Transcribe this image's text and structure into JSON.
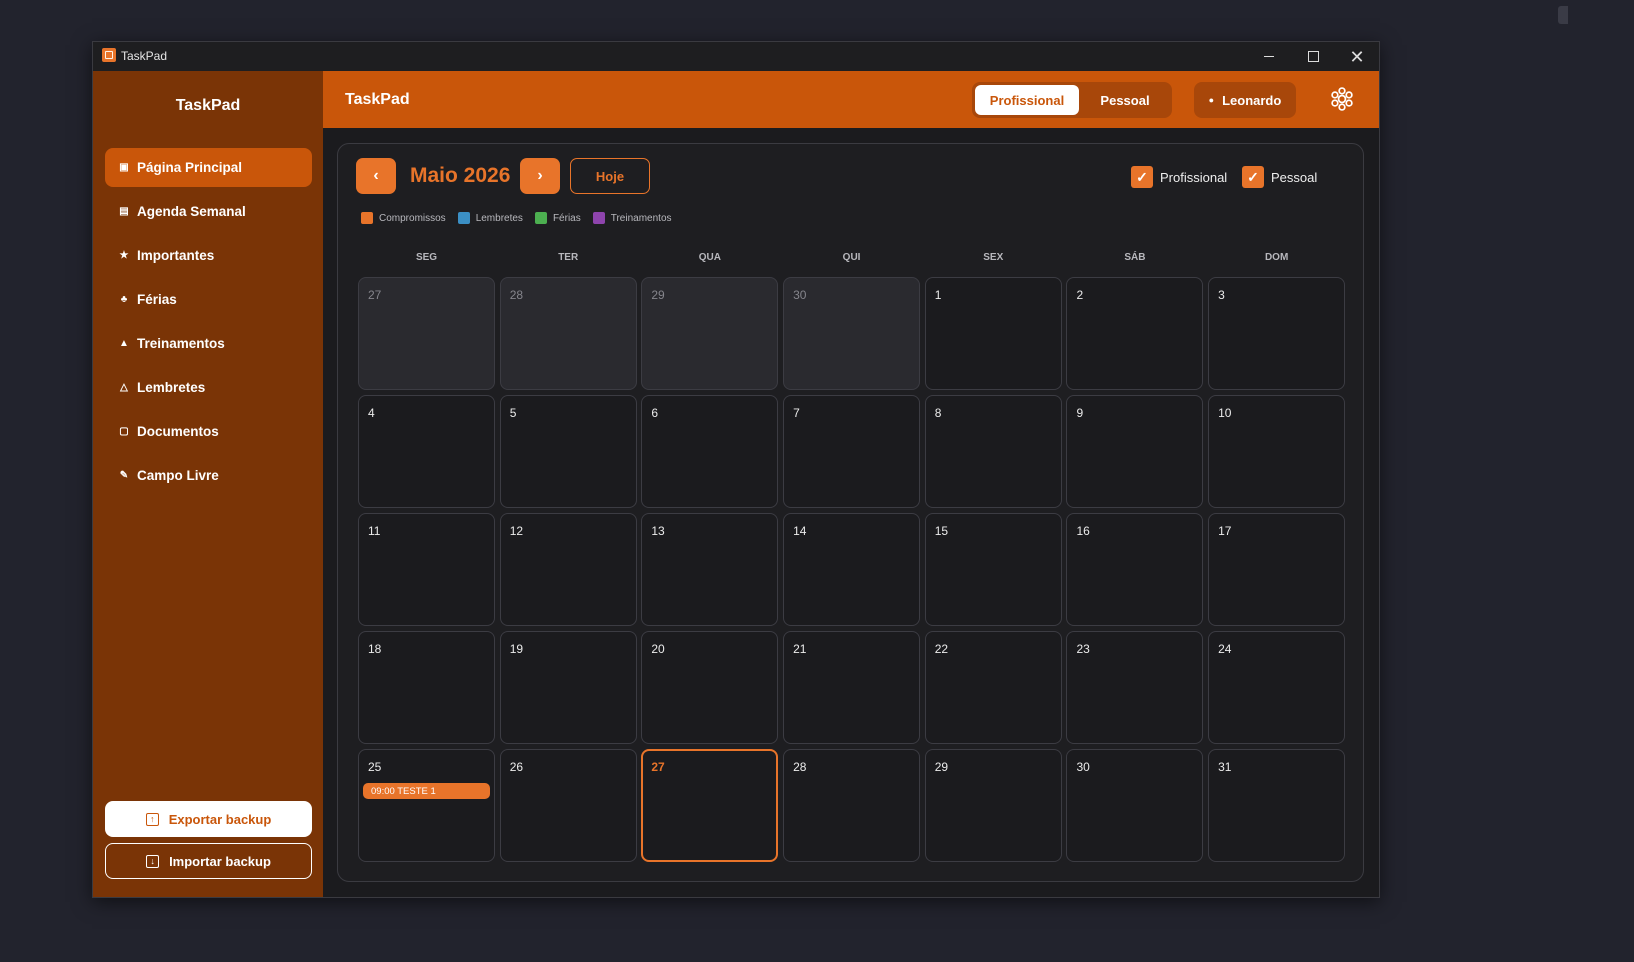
{
  "window": {
    "title": "TaskPad"
  },
  "sidebar": {
    "title": "TaskPad",
    "items": [
      {
        "label": "Página Principal",
        "icon": "calendar-icon",
        "active": true
      },
      {
        "label": "Agenda Semanal",
        "icon": "calendar-week-icon",
        "active": false
      },
      {
        "label": "Importantes",
        "icon": "star-icon",
        "active": false
      },
      {
        "label": "Férias",
        "icon": "palm-tree-icon",
        "active": false
      },
      {
        "label": "Treinamentos",
        "icon": "graduation-cap-icon",
        "active": false
      },
      {
        "label": "Lembretes",
        "icon": "bell-icon",
        "active": false
      },
      {
        "label": "Documentos",
        "icon": "lock-icon",
        "active": false
      },
      {
        "label": "Campo Livre",
        "icon": "pencil-icon",
        "active": false
      }
    ],
    "export_label": "Exportar backup",
    "import_label": "Importar backup"
  },
  "header": {
    "title": "TaskPad",
    "mode_options": [
      "Profissional",
      "Pessoal"
    ],
    "mode_selected": "Profissional",
    "user_name": "Leonardo"
  },
  "calendar": {
    "month_label": "Maio 2026",
    "prev_label": "‹",
    "next_label": "›",
    "today_label": "Hoje",
    "filters": [
      {
        "label": "Profissional",
        "checked": true
      },
      {
        "label": "Pessoal",
        "checked": true
      }
    ],
    "legend": [
      {
        "label": "Compromissos",
        "color": "#e8742a"
      },
      {
        "label": "Lembretes",
        "color": "#3b8fc4"
      },
      {
        "label": "Férias",
        "color": "#4caf50"
      },
      {
        "label": "Treinamentos",
        "color": "#8e44ad"
      }
    ],
    "weekdays": [
      "SEG",
      "TER",
      "QUA",
      "QUI",
      "SEX",
      "SÁB",
      "DOM"
    ],
    "weeks": [
      [
        {
          "day": "27",
          "other": true
        },
        {
          "day": "28",
          "other": true
        },
        {
          "day": "29",
          "other": true
        },
        {
          "day": "30",
          "other": true
        },
        {
          "day": "1"
        },
        {
          "day": "2"
        },
        {
          "day": "3"
        }
      ],
      [
        {
          "day": "4"
        },
        {
          "day": "5"
        },
        {
          "day": "6"
        },
        {
          "day": "7"
        },
        {
          "day": "8"
        },
        {
          "day": "9"
        },
        {
          "day": "10"
        }
      ],
      [
        {
          "day": "11"
        },
        {
          "day": "12"
        },
        {
          "day": "13"
        },
        {
          "day": "14"
        },
        {
          "day": "15"
        },
        {
          "day": "16"
        },
        {
          "day": "17"
        }
      ],
      [
        {
          "day": "18"
        },
        {
          "day": "19"
        },
        {
          "day": "20"
        },
        {
          "day": "21"
        },
        {
          "day": "22"
        },
        {
          "day": "23"
        },
        {
          "day": "24"
        }
      ],
      [
        {
          "day": "25",
          "events": [
            "09:00 TESTE 1"
          ]
        },
        {
          "day": "26"
        },
        {
          "day": "27",
          "today": true
        },
        {
          "day": "28"
        },
        {
          "day": "29"
        },
        {
          "day": "30"
        },
        {
          "day": "31"
        }
      ]
    ]
  },
  "colors": {
    "accent": "#e8742a",
    "sidebar": "#7a3406",
    "header": "#c9560a"
  }
}
